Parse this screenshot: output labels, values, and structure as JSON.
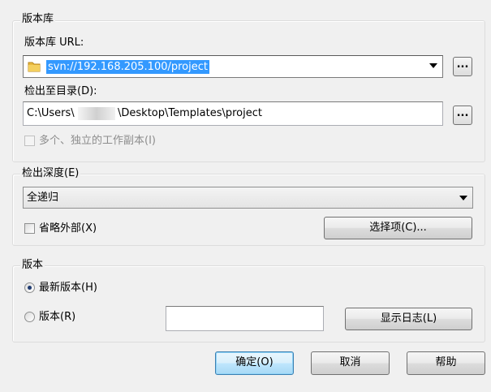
{
  "repository": {
    "group_title": "版本库",
    "url_label": "版本库 URL:",
    "url_value": "svn://192.168.205.100/project",
    "browse_button": "...",
    "checkout_dir_label": "检出至目录(D):",
    "checkout_dir_prefix": "C:\\Users\\",
    "checkout_dir_suffix": "\\Desktop\\Templates\\project",
    "checkout_browse_button": "...",
    "multiple_checkbox_label": "多个、独立的工作副本(I)"
  },
  "depth": {
    "group_title": "检出深度(E)",
    "selected": "全递归",
    "omit_externals_label": "省略外部(X)",
    "items_button": "选择项(C)..."
  },
  "revision": {
    "group_title": "版本",
    "head_label": "最新版本(H)",
    "revision_label": "版本(R)",
    "revision_value": "",
    "show_log_button": "显示日志(L)"
  },
  "footer": {
    "ok_button": "确定(O)",
    "cancel_button": "取消",
    "help_button": "帮助"
  },
  "colors": {
    "selection": "#3399ff",
    "folder": "#e8b83e"
  }
}
